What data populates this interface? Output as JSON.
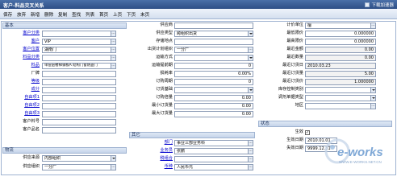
{
  "window": {
    "title": "客户-料品交叉关系",
    "download_label": "下载加速器"
  },
  "toolbar": [
    "保存",
    "放弃",
    "新增",
    "删除",
    "复制",
    "查找",
    "列表",
    "首页",
    "上页",
    "下页",
    "末页"
  ],
  "sections": {
    "basic": "基本",
    "logistics": "物流",
    "other": "其它",
    "status": "状态"
  },
  "col1": {
    "customer_category": {
      "label": "客户分类",
      "value": ""
    },
    "customer": {
      "label": "客户",
      "value": "VIP"
    },
    "customer_site": {
      "label": "客户位置",
      "value": "湖南门"
    },
    "item_category": {
      "label": "料品分类",
      "value": ""
    },
    "item": {
      "label": "料品",
      "value": "单层层楼梯钢板A 结构门窗防盗门"
    },
    "brand": {
      "label": "厂牌",
      "value": ""
    },
    "grade": {
      "label": "等级",
      "value": ""
    },
    "component": {
      "label": "成分",
      "value": ""
    },
    "custom1": {
      "label": "自由项1",
      "value": ""
    },
    "custom2": {
      "label": "自由项2",
      "value": ""
    },
    "custom3": {
      "label": "自由项3",
      "value": ""
    },
    "customer_item_no": {
      "label": "客户料号",
      "value": ""
    },
    "customer_item_name": {
      "label": "客户品名",
      "value": ""
    },
    "supply_source": {
      "label": "供应来源",
      "value": "内部组织"
    },
    "supply_org": {
      "label": "供应组织",
      "value": "一分厂"
    }
  },
  "col2": {
    "supply_section": {
      "label": "供应商",
      "value": ""
    },
    "supply_type": {
      "label": "供应类型",
      "value": "跨组织出货"
    },
    "stock_site": {
      "label": "存储地点",
      "value": ""
    },
    "ship_plan_org": {
      "label": "出货计划组织",
      "value": "一分厂"
    },
    "transport": {
      "label": "运输方式",
      "value": ""
    },
    "transport_lead": {
      "label": "运输提前期",
      "value": "0"
    },
    "loss_rate": {
      "label": "损耗率",
      "value": "0.00%"
    },
    "order_cycle": {
      "label": "订购周期",
      "value": "0"
    },
    "order_base": {
      "label": "订货基础",
      "value": ""
    },
    "order_multiple": {
      "label": "订购倍量",
      "value": "0.00"
    },
    "min_order": {
      "label": "最小订货量",
      "value": "0.00"
    },
    "max_order": {
      "label": "最大订货量",
      "value": "0.00"
    },
    "department": {
      "label": "部门",
      "value": "事业三部业务科"
    },
    "salesperson": {
      "label": "业务员",
      "value": "张鹏"
    },
    "tax_group": {
      "label": "税组合",
      "value": ""
    },
    "currency": {
      "label": "币种",
      "value": "人民币元"
    }
  },
  "col3": {
    "pricing_unit": {
      "label": "计价单位",
      "value": "檀"
    },
    "lowest_price": {
      "label": "最低限价",
      "value": "0.000000"
    },
    "highest_price": {
      "label": "最高限价",
      "value": "0.000000"
    },
    "latest_amount": {
      "label": "最近金额",
      "value": "0.00"
    },
    "latest_qty": {
      "label": "最近数量",
      "value": "0.00"
    },
    "latest_order_date": {
      "label": "最近订货日",
      "value": "2010.03.23"
    },
    "latest_order_qty": {
      "label": "最近订货量",
      "value": "5.00"
    },
    "latest_order_price": {
      "label": "最近订货价",
      "value": "1.000000"
    },
    "stock_control": {
      "label": "库存控制类别",
      "value": ""
    },
    "adjust_unit": {
      "label": "调剂单据类型",
      "value": ""
    },
    "region": {
      "label": "地区",
      "value": ""
    },
    "effective": {
      "label": "生效",
      "checked": "✓"
    },
    "effective_date": {
      "label": "生效日期",
      "value": "2010.01.01"
    },
    "expiry_date": {
      "label": "失效日期",
      "value": "9999.12.31"
    }
  },
  "logo": {
    "text": "e-works",
    "subtitle": "WWW.E-WORKS.NET.CN"
  }
}
